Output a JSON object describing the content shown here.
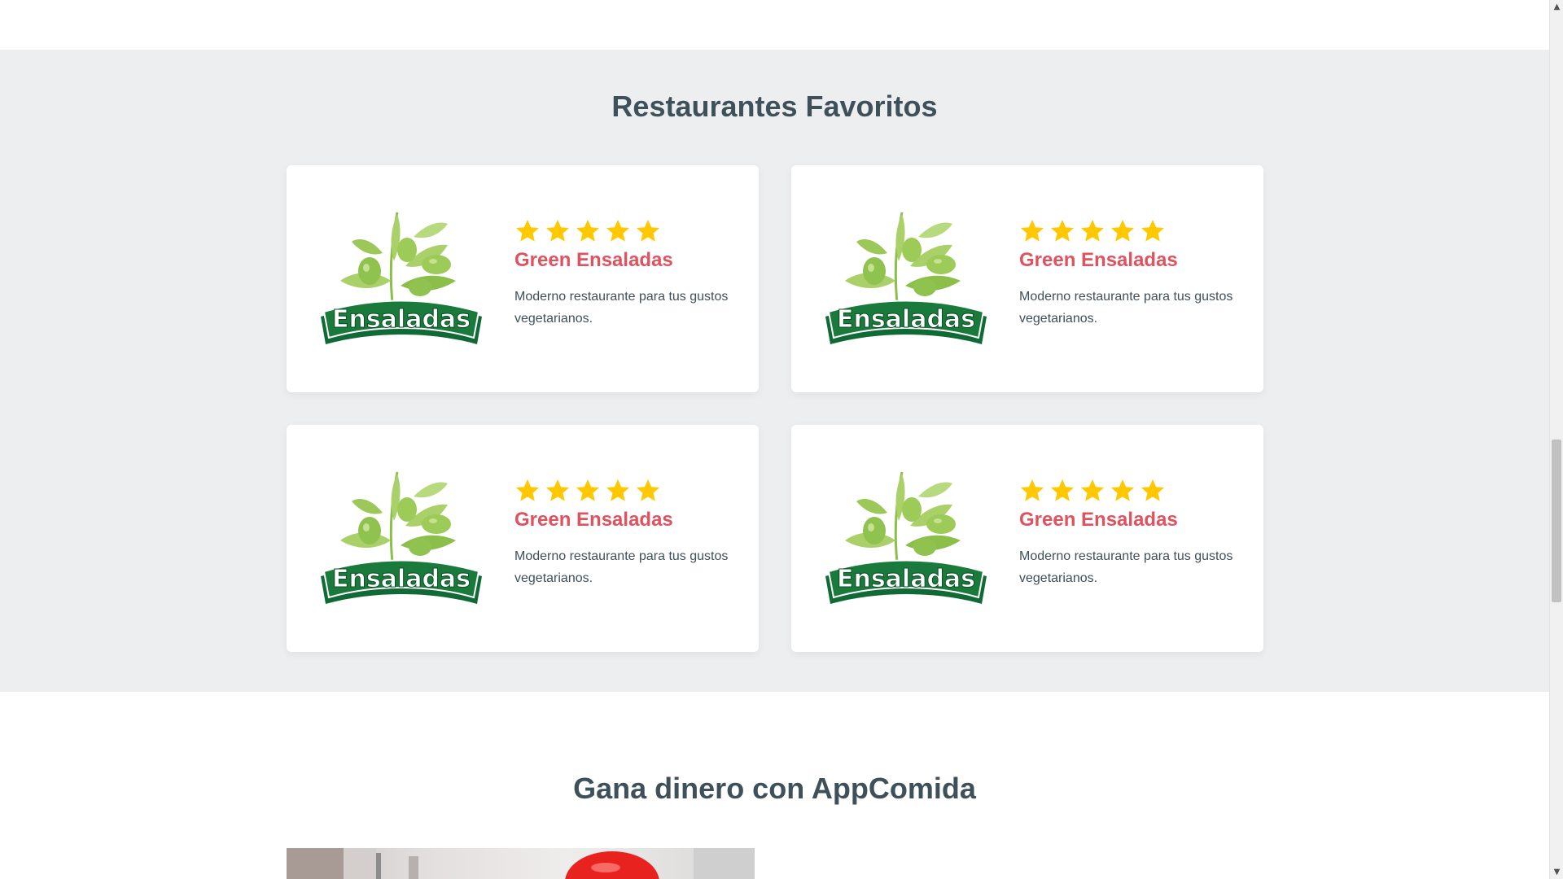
{
  "favorites": {
    "title": "Restaurantes Favoritos",
    "cards": [
      {
        "logo_text": "Ensaladas",
        "rating": 5,
        "name": "Green Ensaladas",
        "description": "Moderno restaurante para tus gustos vegetarianos."
      },
      {
        "logo_text": "Ensaladas",
        "rating": 5,
        "name": "Green Ensaladas",
        "description": "Moderno restaurante para tus gustos vegetarianos."
      },
      {
        "logo_text": "Ensaladas",
        "rating": 5,
        "name": "Green Ensaladas",
        "description": "Moderno restaurante para tus gustos vegetarianos."
      },
      {
        "logo_text": "Ensaladas",
        "rating": 5,
        "name": "Green Ensaladas",
        "description": "Moderno restaurante para tus gustos vegetarianos."
      }
    ]
  },
  "earn": {
    "title": "Gana dinero con AppComida"
  },
  "colors": {
    "accent": "#e0525e",
    "heading": "#3e5059",
    "star": "#ffc800",
    "section_bg": "#edeef0",
    "logo_green": "#1a7a3c"
  },
  "scrollbar": {
    "up_icon": "chevron-up-icon",
    "down_icon": "chevron-down-icon"
  }
}
